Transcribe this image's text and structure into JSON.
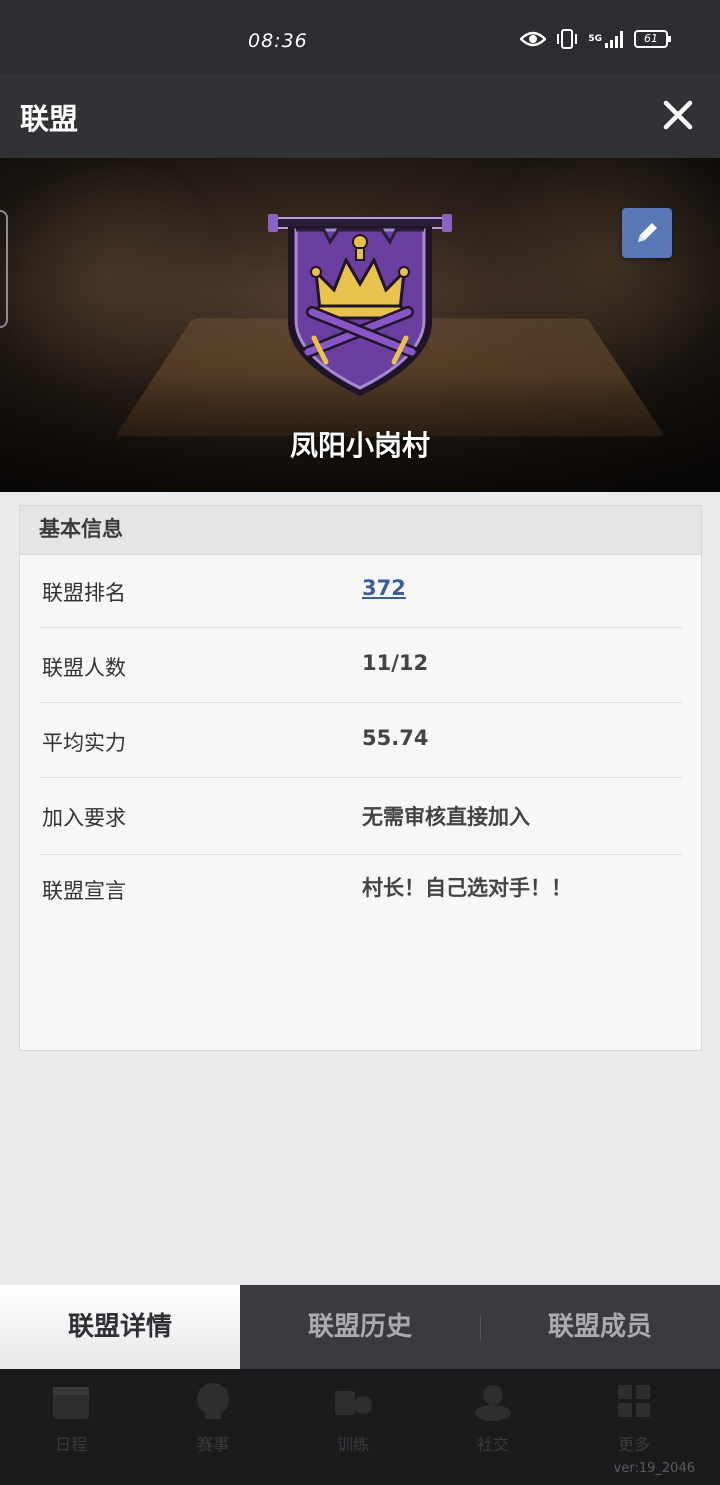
{
  "status_bar": {
    "time": "08:36",
    "network": "5G",
    "battery": "61"
  },
  "header": {
    "title": "联盟"
  },
  "banner": {
    "league_name": "凤阳小岗村"
  },
  "info": {
    "section_title": "基本信息",
    "rows": [
      {
        "label": "联盟排名",
        "value": "372"
      },
      {
        "label": "联盟人数",
        "value": "11/12"
      },
      {
        "label": "平均实力",
        "value": "55.74"
      },
      {
        "label": "加入要求",
        "value": "无需审核直接加入"
      },
      {
        "label": "联盟宣言",
        "value": "村长！自己选对手！！"
      }
    ]
  },
  "tabs": [
    {
      "label": "联盟详情",
      "active": true
    },
    {
      "label": "联盟历史",
      "active": false
    },
    {
      "label": "联盟成员",
      "active": false
    }
  ],
  "bottom_nav": {
    "items": [
      {
        "label": "日程",
        "icon": "calendar-icon"
      },
      {
        "label": "赛事",
        "icon": "globe-icon"
      },
      {
        "label": "训练",
        "icon": "training-icon"
      },
      {
        "label": "社交",
        "icon": "group-icon"
      },
      {
        "label": "更多",
        "icon": "grid-icon"
      }
    ],
    "version": "ver:19_2046"
  },
  "colors": {
    "emblem_purple": "#6b3fa0",
    "emblem_gold": "#e8c24a",
    "link_blue": "#3a5e9e",
    "edit_button": "#5a77b6"
  }
}
